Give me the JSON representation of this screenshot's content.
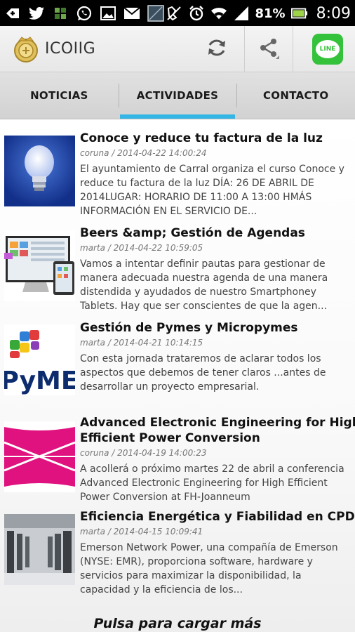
{
  "status_bar": {
    "battery_percent": "81%",
    "time": "8:09",
    "icons": [
      "add-icon",
      "twitter-icon",
      "puzzle-icon",
      "whatsapp-icon",
      "image-icon",
      "mail-icon",
      "screenshot-icon",
      "no-sim-icon",
      "alarm-icon",
      "wifi-icon",
      "signal-icon",
      "battery-icon"
    ]
  },
  "action_bar": {
    "title": "ICOIIG",
    "actions": [
      "refresh-icon",
      "share-icon",
      "line-app-icon"
    ],
    "line_label": "LINE"
  },
  "tabs": [
    {
      "label": "NOTICIAS",
      "active": false
    },
    {
      "label": "ACTIVIDADES",
      "active": true
    },
    {
      "label": "CONTACTO",
      "active": false
    }
  ],
  "articles": [
    {
      "title": "Conoce y reduce tu factura de la luz",
      "meta": "coruna / 2014-04-22 14:00:24",
      "summary": "El ayuntamiento de Carral organiza el curso Conoce y reduce tu factura de la luz DÍA: 26 DE ABRIL DE 2014LUGAR: HORARIO DE 11:00 A 13:00 HMÁS INFORMACIÓN EN EL SERVICIO DE...",
      "thumb": "lightbulb"
    },
    {
      "title": "Beers &amp; Gestión de Agendas",
      "meta": "marta / 2014-04-22 10:59:05",
      "summary": "Vamos a intentar definir pautas para gestionar de manera adecuada nuestra agenda de una manera distendida y ayudados de nuestro Smartphoney Tablets. Hay que ser conscientes de que la agen...",
      "thumb": "devices"
    },
    {
      "title": "Gestión de Pymes y Micropymes",
      "meta": "marta / 2014-04-21 10:14:15",
      "summary": "Con esta jornada trataremos de aclarar todos los aspectos que debemos de tener claros ...antes de desarrollar un proyecto empresarial.",
      "thumb": "pymes",
      "thumb_text": "PyME"
    },
    {
      "title_lines": [
        "Advanced Electronic Engineering for High",
        "Efficient Power Conversion"
      ],
      "meta": "coruna / 2014-04-19 14:00:23",
      "summary": "A  acollerá o próximo martes 22 de abril a conferencia Advanced Electronic Engineering for High Efficient Power Conversion at FH-Joanneum",
      "thumb": "magenta-logo"
    },
    {
      "title": "Eficiencia Energética y Fiabilidad en CPD´s",
      "meta": "marta / 2014-04-15 10:09:41",
      "summary": "Emerson Network Power, una compañía de Emerson (NYSE: EMR), proporciona software, hardware y servicios para maximizar la disponibilidad, la capacidad y la eficiencia de los...",
      "thumb": "datacenter"
    }
  ],
  "load_more": "Pulsa para cargar más",
  "colors": {
    "tab_indicator": "#33b5e5",
    "line_green": "#35c23b",
    "status_bar": "#000000"
  }
}
